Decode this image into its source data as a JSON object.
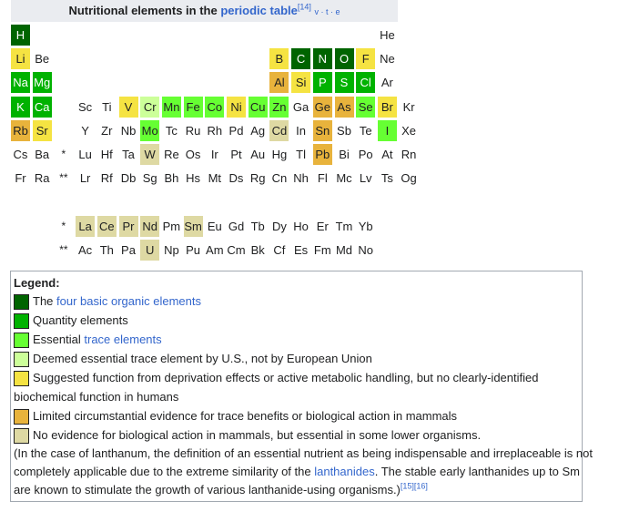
{
  "title": {
    "prefix": "Nutritional elements in the ",
    "link": "periodic table",
    "ref": "[14]",
    "vte": "v · t · e"
  },
  "colors": {
    "dg": "#006400",
    "mg": "#00b200",
    "lg": "#66ff33",
    "pg": "#ccff99",
    "y": "#f5e342",
    "o": "#e8b33c",
    "t": "#ded9a3",
    "link": "#3366cc"
  },
  "table_rows": [
    "H:dg,,,,,,,,,,,,,,,,,He",
    "Li:y,Be,,,,,,,,,,,B:y,C:dg,N:dg,O:dg,F:y,Ne",
    "Na:mg,Mg:mg,,,,,,,,,,,Al:o,Si:y,P:mg,S:mg,Cl:mg,Ar",
    "K:mg,Ca:mg,,Sc,Ti,V:y,Cr:pg,Mn:lg,Fe:lg,Co:lg,Ni:y,Cu:lg,Zn:lg,Ga,Ge:o,As:o,Se:lg,Br:y,Kr",
    "Rb:o,Sr:y,,Y,Zr,Nb,Mo:lg,Tc,Ru,Rh,Pd,Ag,Cd:t,In,Sn:o,Sb,Te,I:lg,Xe",
    "Cs,Ba,*,Lu,Hf,Ta,W:t,Re,Os,Ir,Pt,Au,Hg,Tl,Pb:o,Bi,Po,At,Rn",
    "Fr,Ra,**,Lr,Rf,Db,Sg,Bh,Hs,Mt,Ds,Rg,Cn,Nh,Fl,Mc,Lv,Ts,Og"
  ],
  "f_rows": [
    "*,La:t,Ce:t,Pr:t,Nd:t,Pm,Sm:t,Eu,Gd,Tb,Dy,Ho,Er,Tm,Yb",
    "**,Ac,Th,Pa,U:t,Np,Pu,Am,Cm,Bk,Cf,Es,Fm,Md,No"
  ],
  "legend": {
    "heading": "Legend:",
    "item1": {
      "pre": "The ",
      "link": "four basic organic elements",
      "post": ""
    },
    "item2": "Quantity elements",
    "item3": {
      "pre": "Essential ",
      "link": "trace elements",
      "post": ""
    },
    "item4": "Deemed essential trace element by U.S., not by European Union",
    "item5_line1": "Suggested function from deprivation effects or active metabolic handling, but no clearly-identified",
    "item5_line2": "biochemical function in humans",
    "item6": "Limited circumstantial evidence for trace benefits or biological action in mammals",
    "item7": "No evidence for biological action in mammals, but essential in some lower organisms.",
    "note_line1": "(In the case of lanthanum, the definition of an essential nutrient as being indispensable and irreplaceable is not",
    "note_line2_pre": "completely applicable due to the extreme similarity of the ",
    "note_line2_link": "lanthanides",
    "note_line2_post": ". The stable early lanthanides up to Sm",
    "note_line3": "are known to stimulate the growth of various lanthanide-using organisms.)",
    "note_refs": "[15][16]"
  }
}
